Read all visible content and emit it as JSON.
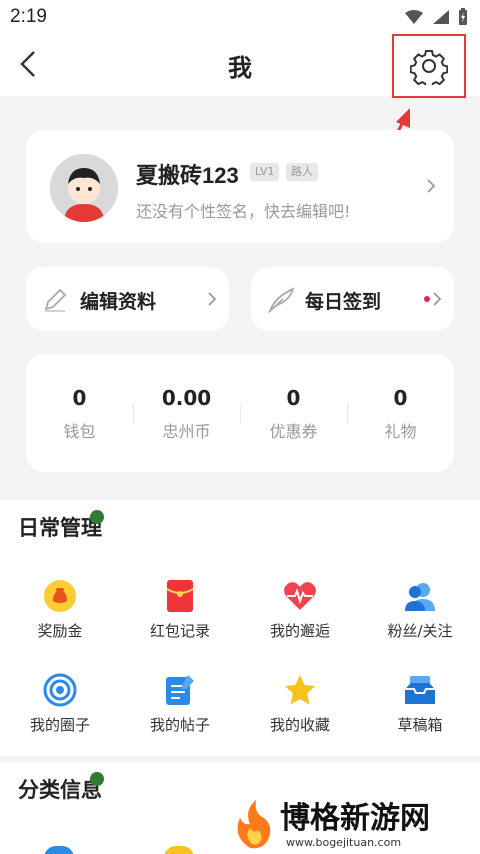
{
  "status": {
    "time": "2:19"
  },
  "nav": {
    "title": "我"
  },
  "profile": {
    "name": "夏搬砖123",
    "level": "LV1",
    "tag": "路人",
    "signature": "还没有个性签名，快去编辑吧!"
  },
  "actions": {
    "edit_label": "编辑资料",
    "checkin_label": "每日签到"
  },
  "stats": [
    {
      "value": "0",
      "label": "钱包"
    },
    {
      "value": "0.00",
      "label": "忠州币"
    },
    {
      "value": "0",
      "label": "优惠券"
    },
    {
      "value": "0",
      "label": "礼物"
    }
  ],
  "daily": {
    "title": "日常管理",
    "items": [
      {
        "label": "奖励金",
        "icon": "reward-icon"
      },
      {
        "label": "红包记录",
        "icon": "red-packet-icon"
      },
      {
        "label": "我的邂逅",
        "icon": "heartbeat-icon"
      },
      {
        "label": "粉丝/关注",
        "icon": "followers-icon"
      },
      {
        "label": "我的圈子",
        "icon": "circle-icon"
      },
      {
        "label": "我的帖子",
        "icon": "posts-icon"
      },
      {
        "label": "我的收藏",
        "icon": "star-icon"
      },
      {
        "label": "草稿箱",
        "icon": "drafts-icon"
      }
    ]
  },
  "category": {
    "title": "分类信息"
  },
  "watermark": {
    "name": "博格新游网",
    "url": "www.bogejituan.com"
  },
  "colors": {
    "accent_red": "#e53935",
    "pink_dot": "#e91e63",
    "green_dot": "#2e7d32"
  }
}
